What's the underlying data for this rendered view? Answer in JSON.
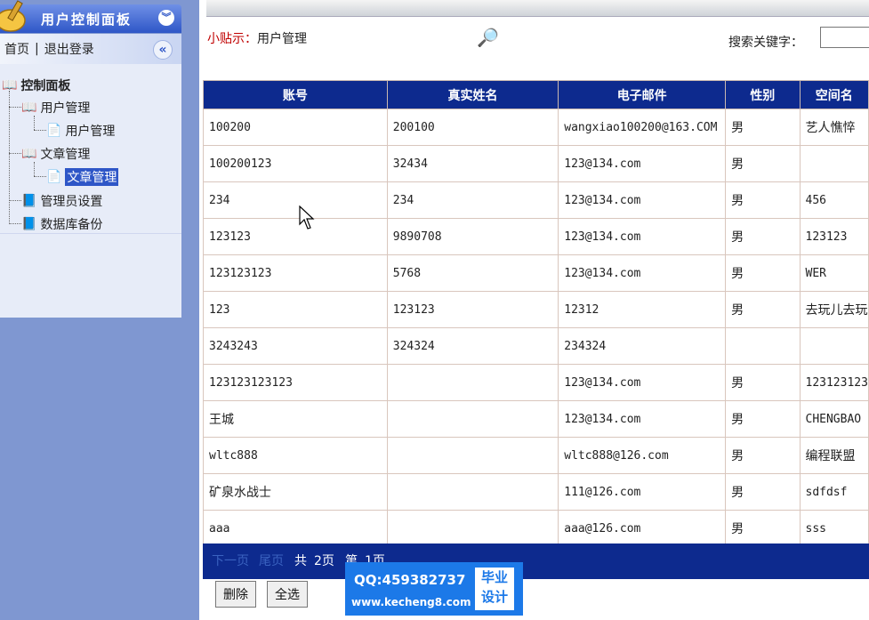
{
  "sidebar": {
    "title": "用户控制面板",
    "home_link": "首页",
    "separator": "|",
    "logout_link": "退出登录",
    "tree": {
      "root": "控制面板",
      "user_management": "用户管理",
      "user_management_child": "用户管理",
      "article_management": "文章管理",
      "article_management_child": "文章管理",
      "admin_settings": "管理员设置",
      "db_backup": "数据库备份"
    }
  },
  "main": {
    "tip_label": "小贴示：",
    "tip_text": "用户管理",
    "search_label": "搜索关键字：",
    "search_value": ""
  },
  "table": {
    "columns": [
      "账号",
      "真实姓名",
      "电子邮件",
      "性别",
      "空间名"
    ],
    "rows": [
      [
        "100200",
        "200100",
        "wangxiao100200@163.COM",
        "男",
        "艺人憔悴"
      ],
      [
        "100200123",
        "32434",
        "123@134.com",
        "男",
        ""
      ],
      [
        "234",
        "234",
        "123@134.com",
        "男",
        "456"
      ],
      [
        "123123",
        "9890708",
        "123@134.com",
        "男",
        "123123"
      ],
      [
        "123123123",
        "5768",
        "123@134.com",
        "男",
        "WER"
      ],
      [
        "123",
        "123123",
        "12312",
        "男",
        "去玩儿去玩"
      ],
      [
        "3243243",
        "324324",
        "234324",
        "",
        ""
      ],
      [
        "123123123123",
        "",
        "123@134.com",
        "男",
        "123123123"
      ],
      [
        "王城",
        "",
        "123@134.com",
        "男",
        "CHENGBAO"
      ],
      [
        "wltc888",
        "",
        "wltc888@126.com",
        "男",
        "编程联盟"
      ],
      [
        "矿泉水战士",
        "",
        "111@126.com",
        "男",
        "sdfdsf"
      ],
      [
        "aaa",
        "",
        "aaa@126.com",
        "男",
        "sss"
      ]
    ]
  },
  "pager": {
    "next": "下一页",
    "last": "尾页",
    "total_prefix": "共",
    "total_pages": "2页",
    "current_prefix": "第",
    "current_page": "1页"
  },
  "buttons": {
    "delete": "删除",
    "select_all": "全选"
  },
  "watermark": {
    "qq": "QQ:459382737",
    "url": "www.kecheng8.com",
    "badge_line1": "毕业",
    "badge_line2": "设计"
  },
  "colors": {
    "header_blue": "#0d2a8e",
    "sidebar_bg": "#7f97d1",
    "tip_red": "#c00000",
    "watermark_blue": "#1c79e8"
  }
}
